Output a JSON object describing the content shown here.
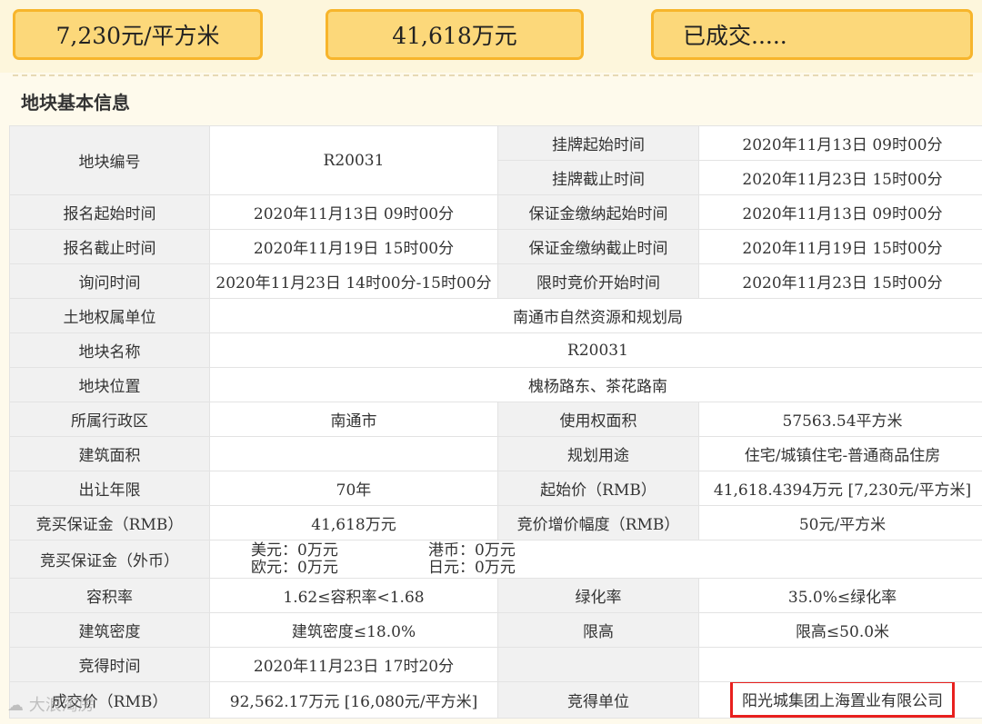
{
  "summary": {
    "unit_price": "7,230元/平方米",
    "total_price": "41,618万元",
    "status": "已成交....."
  },
  "section_title": "地块基本信息",
  "rows": {
    "r1": {
      "l1": "地块编号",
      "v1": "R20031",
      "l2a": "挂牌起始时间",
      "v2a": "2020年11月13日 09时00分",
      "l2b": "挂牌截止时间",
      "v2b": "2020年11月23日 15时00分"
    },
    "r2": {
      "l1": "报名起始时间",
      "v1": "2020年11月13日 09时00分",
      "l2": "保证金缴纳起始时间",
      "v2": "2020年11月13日 09时00分"
    },
    "r3": {
      "l1": "报名截止时间",
      "v1": "2020年11月19日 15时00分",
      "l2": "保证金缴纳截止时间",
      "v2": "2020年11月19日 15时00分"
    },
    "r4": {
      "l1": "询问时间",
      "v1": "2020年11月23日 14时00分-15时00分",
      "l2": "限时竞价开始时间",
      "v2": "2020年11月23日 15时00分"
    },
    "r5": {
      "l1": "土地权属单位",
      "v1": "南通市自然资源和规划局"
    },
    "r6": {
      "l1": "地块名称",
      "v1": "R20031"
    },
    "r7": {
      "l1": "地块位置",
      "v1": "槐杨路东、茶花路南"
    },
    "r8": {
      "l1": "所属行政区",
      "v1": "南通市",
      "l2": "使用权面积",
      "v2": "57563.54平方米"
    },
    "r9": {
      "l1": "建筑面积",
      "v1": "",
      "l2": "规划用途",
      "v2": "住宅/城镇住宅-普通商品住房"
    },
    "r10": {
      "l1": "出让年限",
      "v1": "70年",
      "l2": "起始价（RMB）",
      "v2": "41,618.4394万元 [7,230元/平方米]"
    },
    "r11": {
      "l1": "竞买保证金（RMB）",
      "v1": "41,618万元",
      "l2": "竞价增价幅度（RMB）",
      "v2": "50元/平方米"
    },
    "r12": {
      "l1": "竞买保证金（外币）",
      "usd": "美元：0万元",
      "hkd": "港币：0万元",
      "eur": "欧元：0万元",
      "jpy": "日元：0万元"
    },
    "r13": {
      "l1": "容积率",
      "v1": "1.62≤容积率<1.68",
      "l2": "绿化率",
      "v2": "35.0%≤绿化率"
    },
    "r14": {
      "l1": "建筑密度",
      "v1": "建筑密度≤18.0%",
      "l2": "限高",
      "v2": "限高≤50.0米"
    },
    "r15": {
      "l1": "竞得时间",
      "v1": "2020年11月23日 17时20分",
      "l2": "",
      "v2": ""
    },
    "r16": {
      "l1": "成交价（RMB）",
      "v1": "92,562.17万元 [16,080元/平方米]",
      "l2": "竞得单位",
      "v2": "阳光城集团上海置业有限公司"
    }
  },
  "watermark": "大浪淘房",
  "colors": {
    "box_fill": "#fcd87a",
    "box_border": "#f7b52c",
    "highlight": "#e8201e"
  }
}
